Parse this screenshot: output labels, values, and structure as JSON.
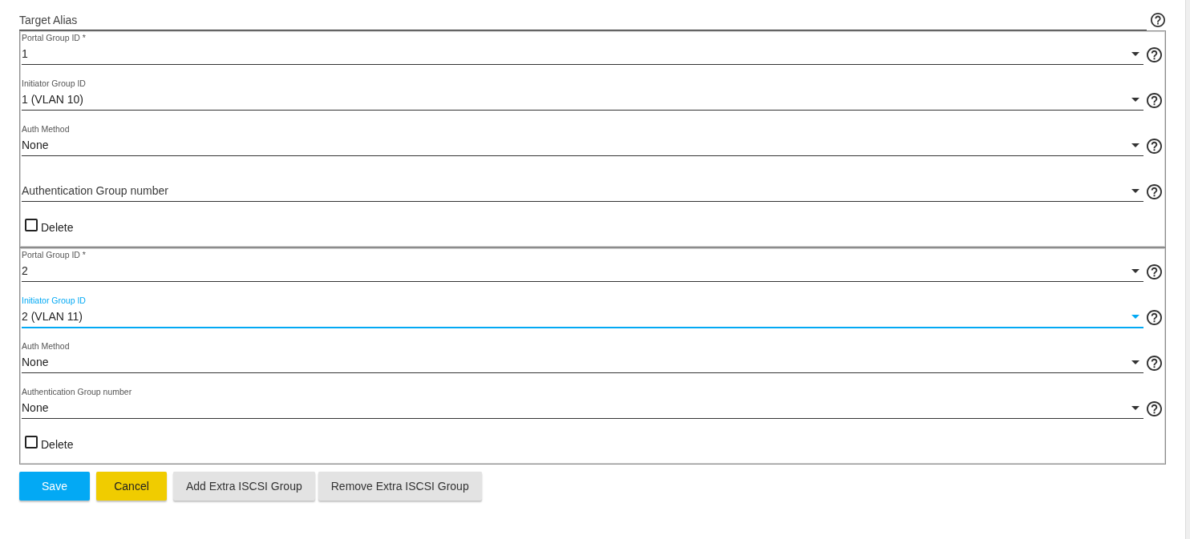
{
  "target_alias": {
    "placeholder": "Target Alias"
  },
  "groups": [
    {
      "fields": [
        {
          "label": "Portal Group ID *",
          "value": "1",
          "focused": false
        },
        {
          "label": "Initiator Group ID",
          "value": "1 (VLAN 10)",
          "focused": false
        },
        {
          "label": "Auth Method",
          "value": "None",
          "focused": false
        },
        {
          "placeholder": "Authentication Group number",
          "focused": false
        }
      ],
      "delete": {
        "label": "Delete",
        "checked": false
      }
    },
    {
      "fields": [
        {
          "label": "Portal Group ID *",
          "value": "2",
          "focused": false
        },
        {
          "label": "Initiator Group ID",
          "value": "2 (VLAN 11)",
          "focused": true
        },
        {
          "label": "Auth Method",
          "value": "None",
          "focused": false
        },
        {
          "label": "Authentication Group number",
          "value": "None",
          "focused": false
        }
      ],
      "delete": {
        "label": "Delete",
        "checked": false
      }
    }
  ],
  "buttons": [
    {
      "label": "Save",
      "kind": "primary"
    },
    {
      "label": "Cancel",
      "kind": "warning"
    },
    {
      "label": "Add Extra ISCSI Group",
      "kind": "default"
    },
    {
      "label": "Remove Extra ISCSI Group",
      "kind": "default"
    }
  ]
}
